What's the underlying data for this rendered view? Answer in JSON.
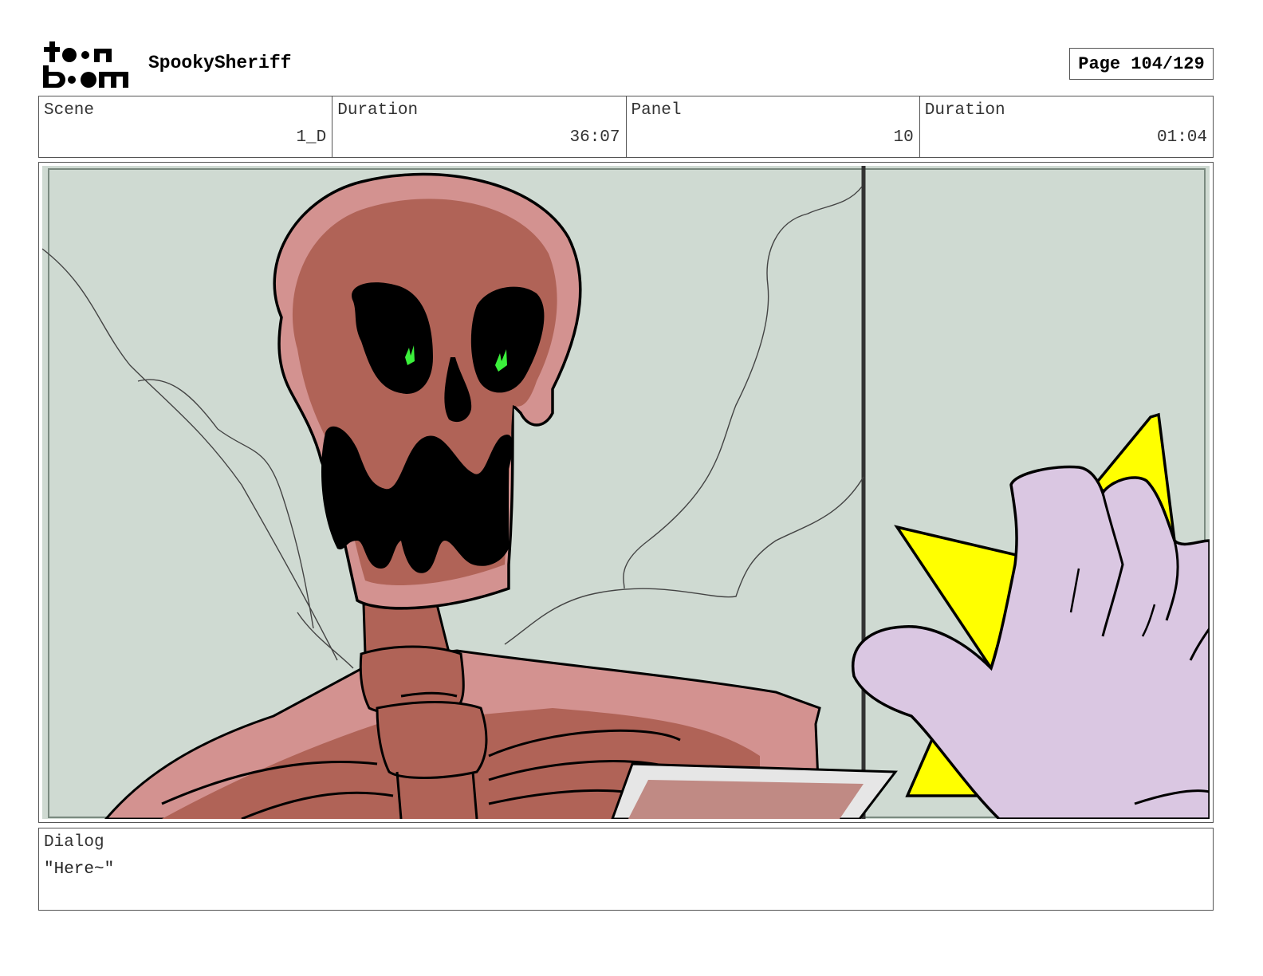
{
  "header": {
    "logo_text": "toon boom",
    "project": "SpookySheriff",
    "page": "Page 104/129"
  },
  "info": {
    "scene_label": "Scene",
    "scene_value": "1_D",
    "scene_duration_label": "Duration",
    "scene_duration_value": "36:07",
    "panel_label": "Panel",
    "panel_value": "10",
    "panel_duration_label": "Duration",
    "panel_duration_value": "01:04"
  },
  "dialog": {
    "label": "Dialog",
    "text": "\"Here~\""
  },
  "colors": {
    "background_wall": "#cfdad2",
    "skull_dark": "#b06357",
    "skull_light": "#d39290",
    "eye_glow": "#3bf03b",
    "glove": "#dac7e2",
    "star": "#ffff00"
  }
}
